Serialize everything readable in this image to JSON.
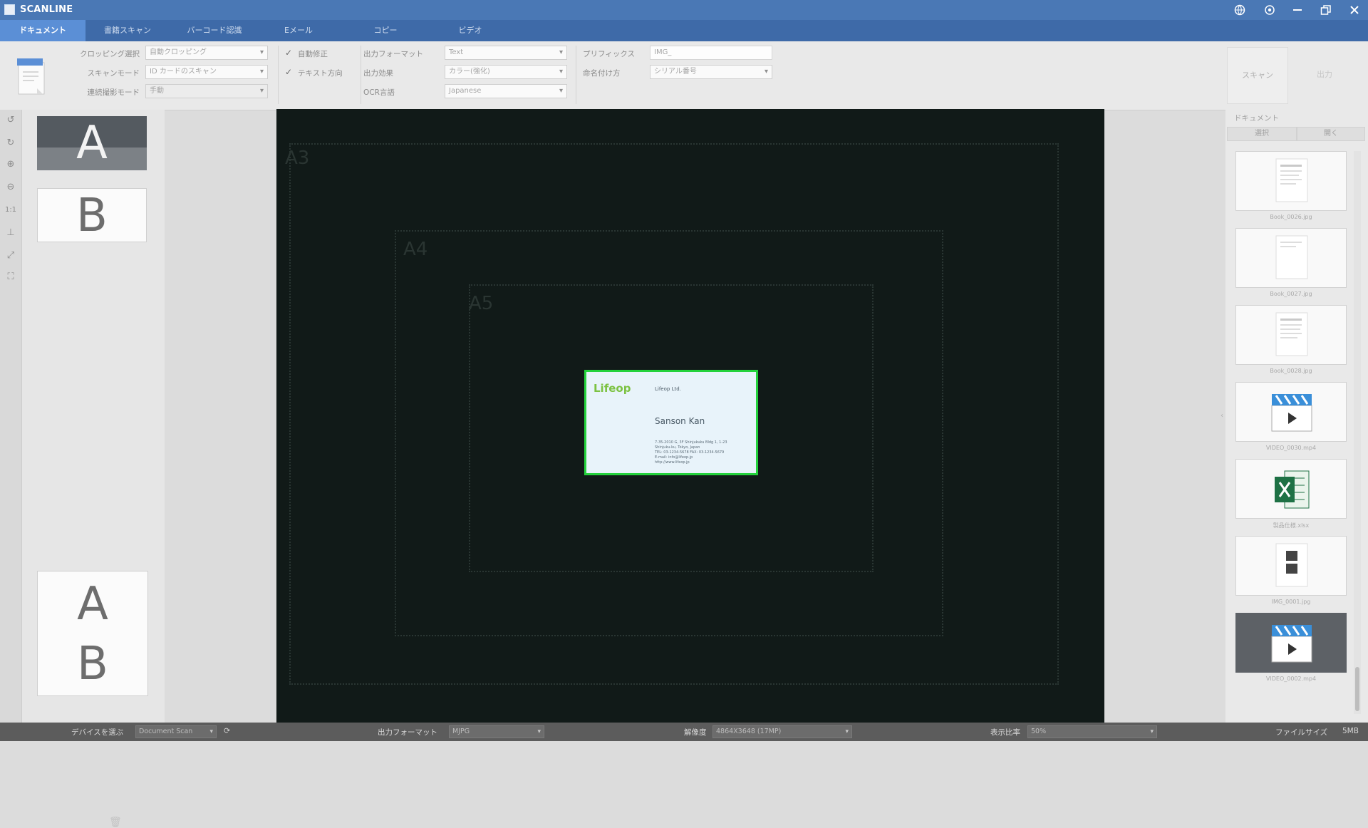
{
  "window": {
    "title": "SCANLINE"
  },
  "tabs": [
    {
      "label": "ドキュメント",
      "active": true
    },
    {
      "label": "書籍スキャン",
      "active": false
    },
    {
      "label": "バーコード認識",
      "active": false
    },
    {
      "label": "Eメール",
      "active": false
    },
    {
      "label": "コピー",
      "active": false
    },
    {
      "label": "ビデオ",
      "active": false
    }
  ],
  "ribbon": {
    "cropping_label": "クロッピング選択",
    "cropping_value": "自動クロッピング",
    "scan_mode_label": "スキャンモード",
    "scan_mode_value": "ID カードのスキャン",
    "continuous_label": "連続撮影モード",
    "continuous_value": "手動",
    "auto_correct_label": "自動修正",
    "text_direction_label": "テキスト方向",
    "output_format_label": "出力フォーマット",
    "output_format_value": "Text",
    "output_color_label": "出力効果",
    "output_color_value": "カラー(強化)",
    "ocr_language_label": "OCR言語",
    "ocr_language_value": "Japanese",
    "prefix_label": "プリフィックス",
    "prefix_value": "IMG_",
    "naming_label": "命名付け方",
    "naming_value": "シリアル番号",
    "scan_button": "スキャン",
    "output_button": "出力"
  },
  "left_thumbs": {
    "top_letter": "A",
    "second_letter": "B",
    "bottom_letters": [
      "A",
      "B"
    ]
  },
  "viewer": {
    "guides": [
      "A3",
      "A4",
      "A5"
    ],
    "card": {
      "logo": "Lifeop",
      "company": "Lifeop Ltd.",
      "person": "Sanson Kan",
      "lines": [
        "7-35-2010 G, 3F Shinjukuku Bldg 1, 1-23",
        "Shinjuku-ku, Tokyo, Japan",
        "TEL: 03-1234-5678  FAX: 03-1234-5679",
        "E-mail: info@lifeop.jp",
        "http://www.lifeop.jp"
      ]
    }
  },
  "right_panel": {
    "title": "ドキュメント",
    "select_button": "選択",
    "open_button": "開く",
    "files": [
      {
        "name": "Book_0026.jpg",
        "kind": "doc"
      },
      {
        "name": "Book_0027.jpg",
        "kind": "doc"
      },
      {
        "name": "Book_0028.jpg",
        "kind": "doc"
      },
      {
        "name": "VIDEO_0030.mp4",
        "kind": "video"
      },
      {
        "name": "製品仕様.xlsx",
        "kind": "excel"
      },
      {
        "name": "IMG_0001.jpg",
        "kind": "doc"
      },
      {
        "name": "VIDEO_0002.mp4",
        "kind": "video"
      }
    ]
  },
  "status_bar": {
    "device_label": "デバイスを選ぶ",
    "device_value": "Document Scan",
    "output_format_label": "出力フォーマット",
    "output_format_value": "MJPG",
    "resolution_label": "解像度",
    "resolution_value": "4864X3648 (17MP)",
    "zoom_label": "表示比率",
    "zoom_value": "50%",
    "file_size_label": "ファイルサイズ",
    "file_size_value": "5MB"
  }
}
